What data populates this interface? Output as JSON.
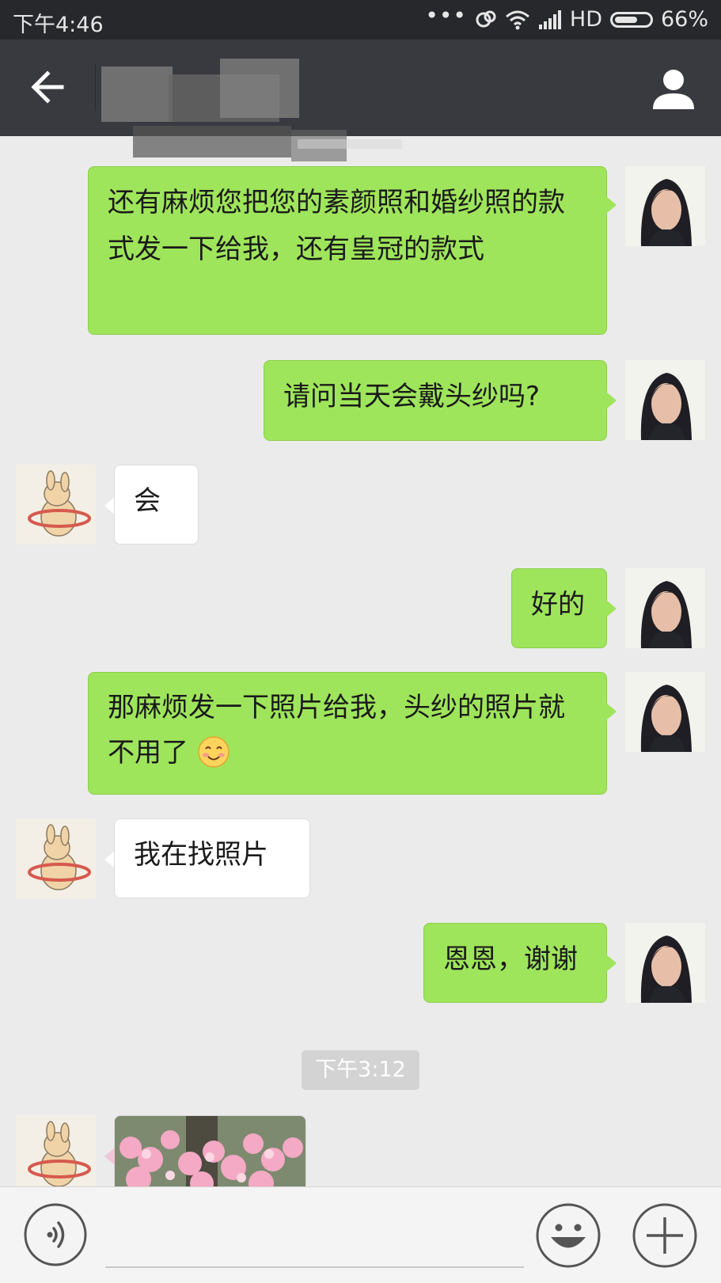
{
  "status_bar": {
    "time": "下午4:46",
    "dots": "•••",
    "network": "HD",
    "battery": "66%",
    "battery_level": 0.66
  },
  "title_bar": {
    "title": ""
  },
  "messages": [
    {
      "side": "out",
      "text": "还有麻烦您把您的素颜照和婚纱照的款式发一下给我，还有皇冠的款式"
    },
    {
      "side": "out",
      "text": "请问当天会戴头纱吗?"
    },
    {
      "side": "in",
      "text": "会"
    },
    {
      "side": "out",
      "text": "好的"
    },
    {
      "side": "out",
      "text": "那麻烦发一下照片给我，头纱的照片就不用了"
    },
    {
      "side": "in",
      "text": "我在找照片"
    },
    {
      "side": "out",
      "text": "恩恩，谢谢"
    },
    {
      "side": "in",
      "type": "image"
    }
  ],
  "timestamp": "下午3:12",
  "input": {
    "value": "",
    "placeholder": ""
  },
  "icons": {
    "back": "arrow-left-icon",
    "profile": "person-icon",
    "voice": "voice-icon",
    "emoji": "emoji-icon",
    "plus": "plus-icon"
  },
  "colors": {
    "outgoing_bubble": "#9fe55b",
    "incoming_bubble": "#ffffff",
    "title_bar": "#393a3f",
    "status_bar": "#27282c",
    "chat_background": "#ebebeb"
  }
}
